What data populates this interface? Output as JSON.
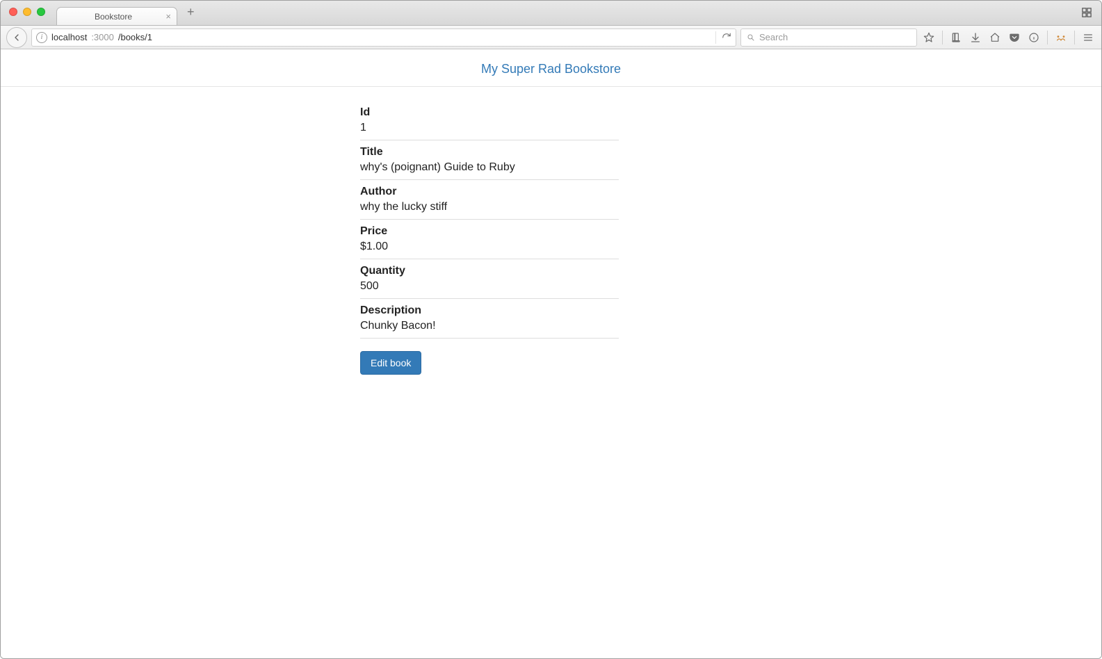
{
  "window": {
    "tab_title": "Bookstore",
    "url_host": "localhost",
    "url_port": ":3000",
    "url_path": "/books/1",
    "search_placeholder": "Search"
  },
  "site": {
    "brand": "My Super Rad Bookstore"
  },
  "book": {
    "fields": {
      "id": {
        "label": "Id",
        "value": "1"
      },
      "title": {
        "label": "Title",
        "value": "why's (poignant) Guide to Ruby"
      },
      "author": {
        "label": "Author",
        "value": "why the lucky stiff"
      },
      "price": {
        "label": "Price",
        "value": "$1.00"
      },
      "quantity": {
        "label": "Quantity",
        "value": "500"
      },
      "description": {
        "label": "Description",
        "value": "Chunky Bacon!"
      }
    }
  },
  "actions": {
    "edit": "Edit book"
  }
}
